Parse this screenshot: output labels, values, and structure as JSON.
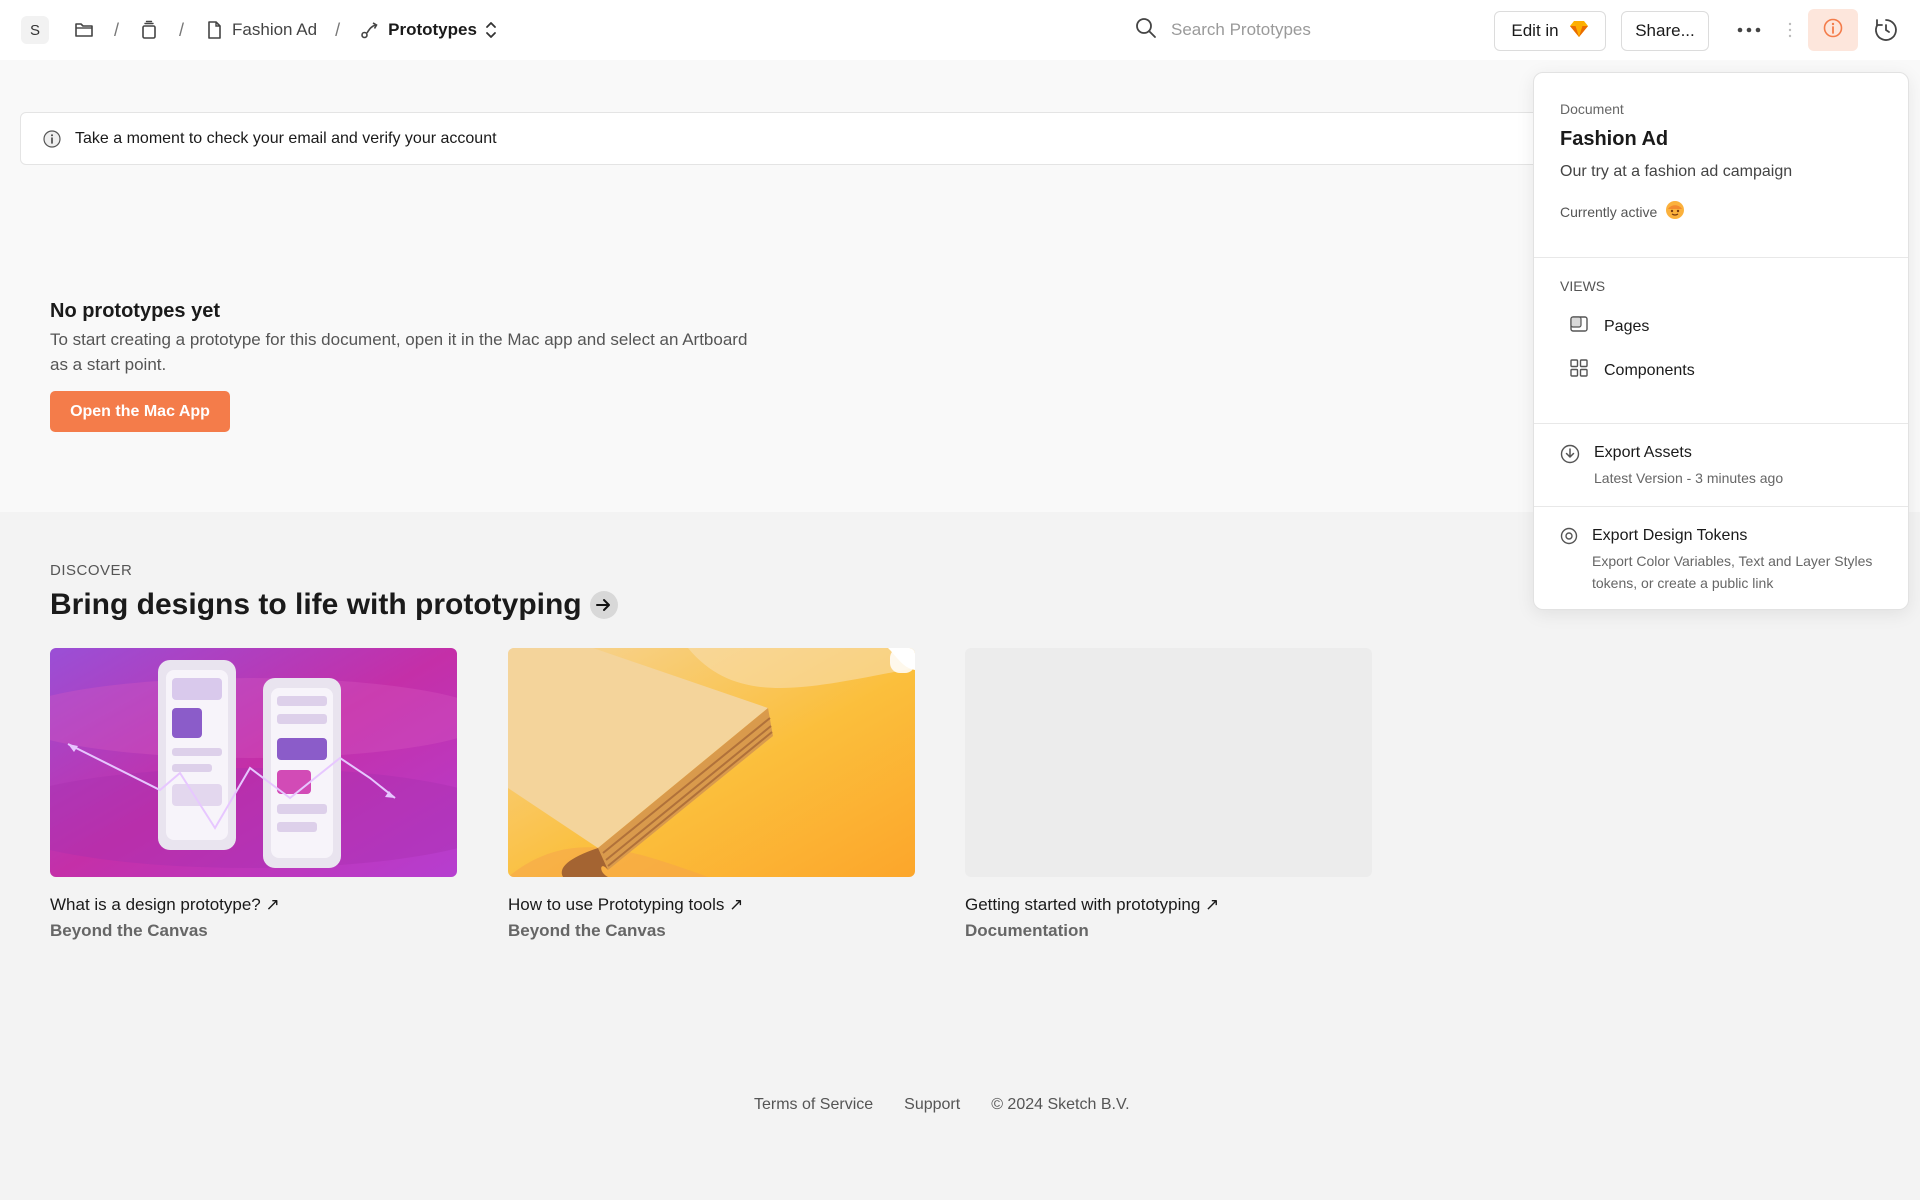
{
  "topbar": {
    "workspace_initial": "S",
    "breadcrumb_document": "Fashion Ad",
    "breadcrumb_current": "Prototypes",
    "search_placeholder": "Search Prototypes",
    "edit_in_label": "Edit in",
    "share_label": "Share..."
  },
  "banner": {
    "text": "Take a moment to check your email and verify your account"
  },
  "empty_state": {
    "title": "No prototypes yet",
    "description": "To start creating a prototype for this document, open it in the Mac app and select an Artboard as a start point.",
    "button_label": "Open the Mac App"
  },
  "discover": {
    "eyebrow": "DISCOVER",
    "title": "Bring designs to life with prototyping",
    "cards": [
      {
        "title": "What is a design prototype? ↗",
        "source": "Beyond the Canvas"
      },
      {
        "title": "How to use Prototyping tools ↗",
        "source": "Beyond the Canvas"
      },
      {
        "title": "Getting started with prototyping ↗",
        "source": "Documentation"
      }
    ]
  },
  "footer": {
    "terms": "Terms of Service",
    "support": "Support",
    "copyright": "© 2024 Sketch B.V."
  },
  "panel": {
    "eyebrow": "Document",
    "title": "Fashion Ad",
    "description": "Our try at a fashion ad campaign",
    "status": "Currently active",
    "views_heading": "VIEWS",
    "views": [
      {
        "label": "Pages",
        "icon": "pages-icon"
      },
      {
        "label": "Components",
        "icon": "components-icon"
      }
    ],
    "export_assets": {
      "title": "Export Assets",
      "subtitle": "Latest Version - 3 minutes ago"
    },
    "export_tokens": {
      "title": "Export Design Tokens",
      "subtitle": "Export Color Variables, Text and Layer Styles tokens, or create a public link"
    }
  },
  "colors": {
    "accent": "#f47c4a",
    "info_button_bg": "#fde6dc"
  }
}
